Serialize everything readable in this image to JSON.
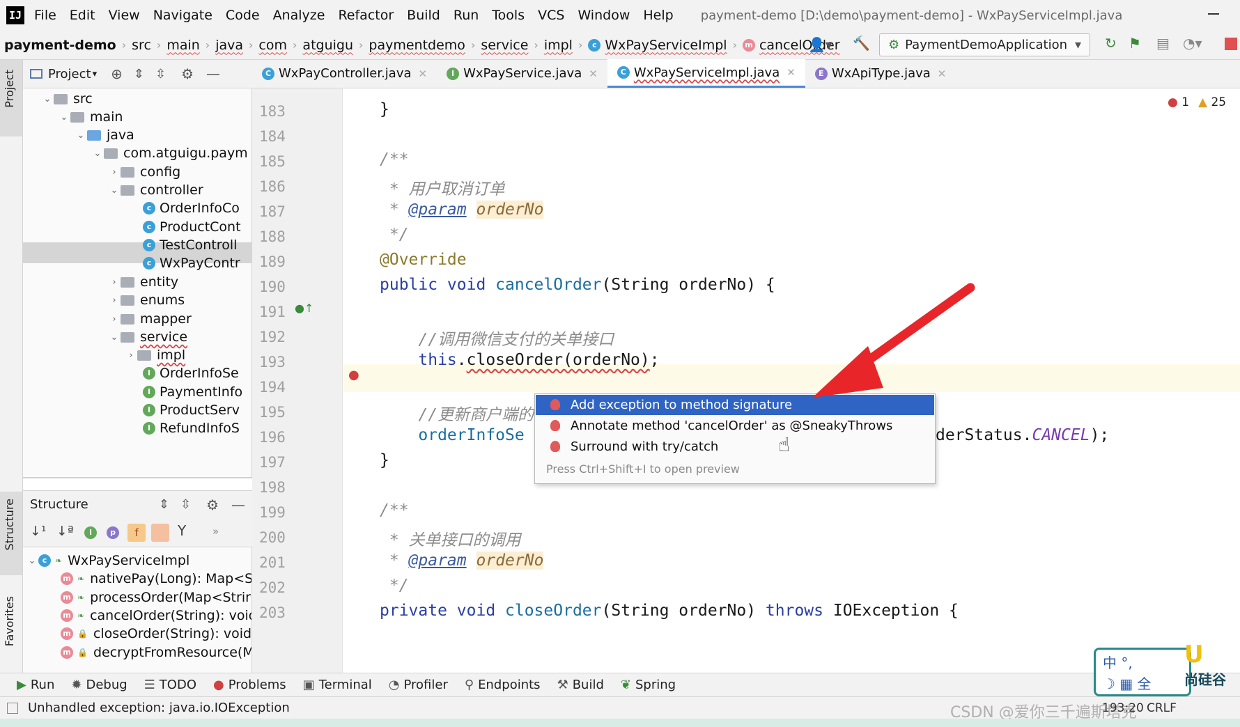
{
  "menu": {
    "logo": "IJ",
    "items": [
      "File",
      "Edit",
      "View",
      "Navigate",
      "Code",
      "Analyze",
      "Refactor",
      "Build",
      "Run",
      "Tools",
      "VCS",
      "Window",
      "Help"
    ],
    "window_title": "payment-demo [D:\\demo\\payment-demo] - WxPayServiceImpl.java"
  },
  "breadcrumb": [
    "payment-demo",
    "src",
    "main",
    "java",
    "com",
    "atguigu",
    "paymentdemo",
    "service",
    "impl",
    "WxPayServiceImpl",
    "cancelOrder"
  ],
  "run_config": "PaymentDemoApplication",
  "tabs": [
    {
      "label": "WxPayController.java",
      "icon": "C"
    },
    {
      "label": "WxPayService.java",
      "icon": "I"
    },
    {
      "label": "WxPayServiceImpl.java",
      "icon": "C"
    },
    {
      "label": "WxApiType.java",
      "icon": "E"
    }
  ],
  "inspection": {
    "errors": "1",
    "warnings": "25"
  },
  "project_panel": {
    "title": "Project",
    "side_label": "Project",
    "tree": [
      {
        "label": "src",
        "type": "folder"
      },
      {
        "label": "main",
        "type": "folder"
      },
      {
        "label": "java",
        "type": "folder-blue"
      },
      {
        "label": "com.atguigu.paym",
        "type": "package"
      },
      {
        "label": "config",
        "type": "folder"
      },
      {
        "label": "controller",
        "type": "folder"
      },
      {
        "label": "OrderInfoCo",
        "type": "class"
      },
      {
        "label": "ProductCont",
        "type": "class"
      },
      {
        "label": "TestControll",
        "type": "class"
      },
      {
        "label": "WxPayContr",
        "type": "class"
      },
      {
        "label": "entity",
        "type": "folder"
      },
      {
        "label": "enums",
        "type": "folder"
      },
      {
        "label": "mapper",
        "type": "folder"
      },
      {
        "label": "service",
        "type": "folder"
      },
      {
        "label": "impl",
        "type": "folder"
      },
      {
        "label": "OrderInfoSe",
        "type": "interface"
      },
      {
        "label": "PaymentInfo",
        "type": "interface"
      },
      {
        "label": "ProductServ",
        "type": "interface"
      },
      {
        "label": "RefundInfoS",
        "type": "interface"
      }
    ]
  },
  "structure_panel": {
    "title": "Structure",
    "side_label": "Structure",
    "root": "WxPayServiceImpl",
    "members": [
      "nativePay(Long): Map<St",
      "processOrder(Map<Strir",
      "cancelOrder(String): void",
      "closeOrder(String): void",
      "decryptFromResource(M"
    ]
  },
  "favorites_label": "Favorites",
  "editor": {
    "line_numbers": [
      "183",
      "184",
      "185",
      "186",
      "187",
      "188",
      "189",
      "190",
      "191",
      "192",
      "193",
      "194",
      "195",
      "196",
      "197",
      "198",
      "199",
      "200",
      "201",
      "202",
      "203"
    ],
    "comment_cancel": "用户取消订单",
    "comment_call_close": "//调用微信支付的关单接口",
    "comment_update": "//更新商户端的",
    "comment_close_api": "关单接口的调用",
    "param_tag": "@param",
    "param_name": "orderNo",
    "override": "@Override",
    "status_tail": "derStatus.",
    "status_const": "CANCEL",
    "update_call_head": "orderInfoSe"
  },
  "popup": {
    "items": [
      "Add exception to method signature",
      "Annotate method 'cancelOrder' as @SneakyThrows",
      "Surround with try/catch"
    ],
    "hint": "Press Ctrl+Shift+I to open preview"
  },
  "bottom_tools": [
    "Run",
    "Debug",
    "TODO",
    "Problems",
    "Terminal",
    "Profiler",
    "Endpoints",
    "Build",
    "Spring"
  ],
  "status": {
    "message": "Unhandled exception: java.io.IOException",
    "position": "193:20",
    "encoding": "CRLF"
  },
  "watermark": "CSDN @爱你三千遍斯塔克",
  "ime": {
    "row1": "中 °,",
    "row2": "☽ ▦ 全"
  },
  "brand": "尚硅谷"
}
